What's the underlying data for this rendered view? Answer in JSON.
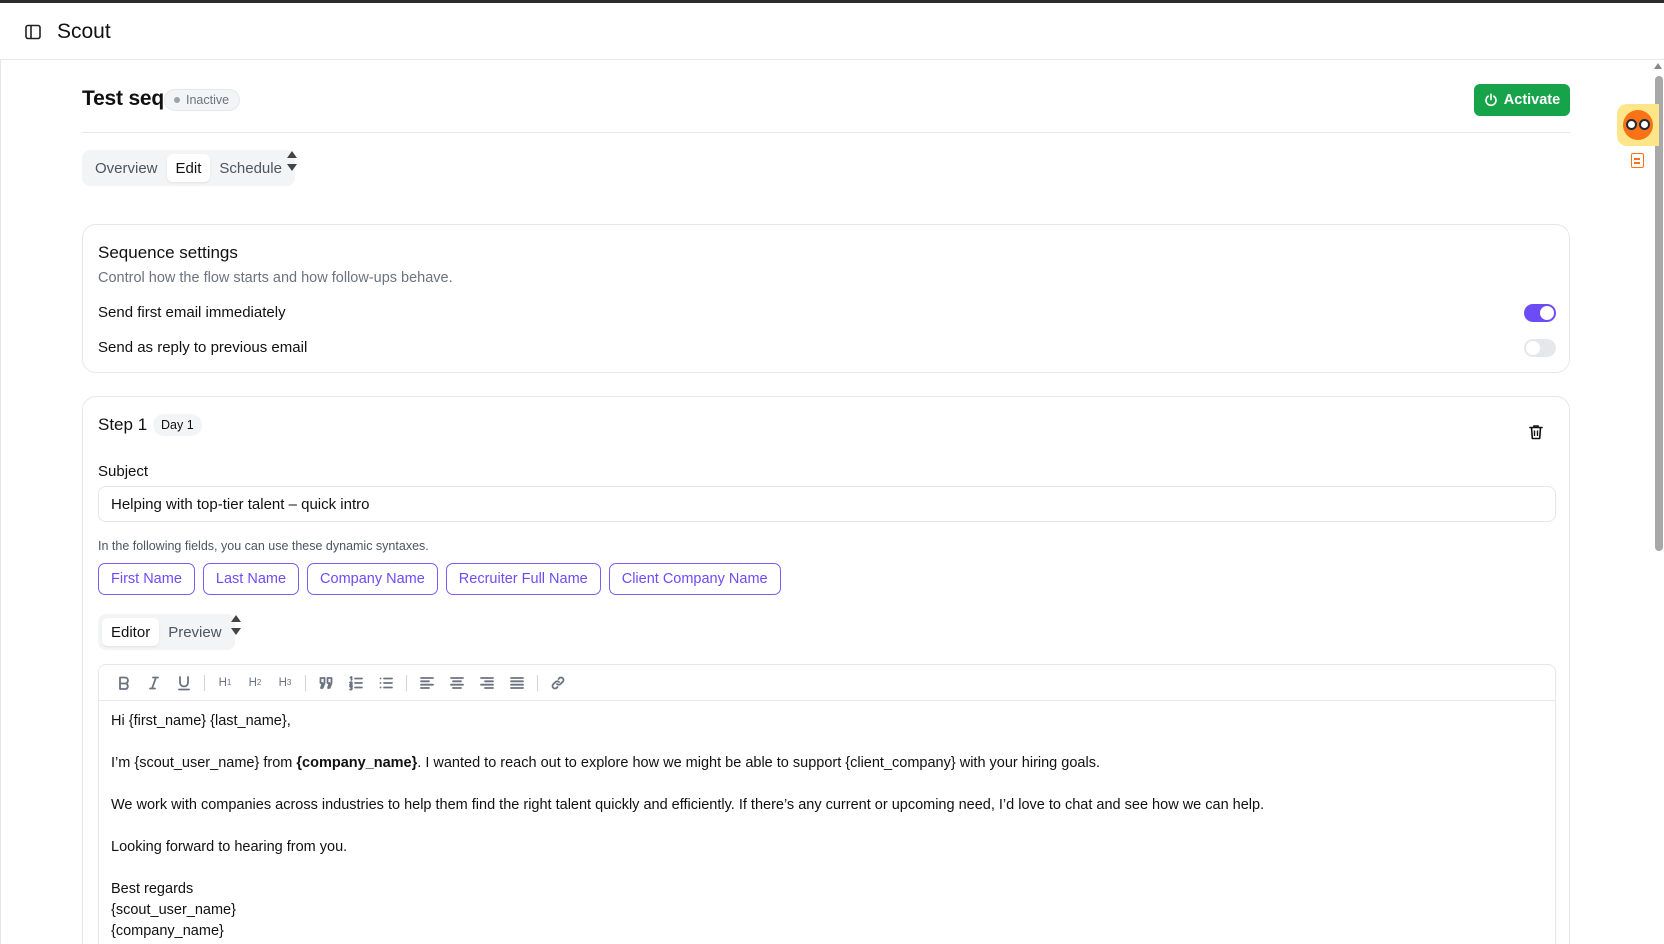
{
  "app": {
    "title": "Scout"
  },
  "page": {
    "title": "Test seq",
    "status": "Inactive",
    "activate_label": "Activate"
  },
  "tabs": [
    {
      "label": "Overview",
      "active": false
    },
    {
      "label": "Edit",
      "active": true
    },
    {
      "label": "Schedule",
      "active": false
    }
  ],
  "settings": {
    "title": "Sequence settings",
    "description": "Control how the flow starts and how follow-ups behave.",
    "items": [
      {
        "label": "Send first email immediately",
        "enabled": true
      },
      {
        "label": "Send as reply to previous email",
        "enabled": false
      }
    ]
  },
  "step": {
    "title": "Step 1",
    "day": "Day 1",
    "subject_label": "Subject",
    "subject_value": "Helping with top-tier talent – quick intro",
    "hint": "In the following fields, you can use these dynamic syntaxes.",
    "chips": [
      "First Name",
      "Last Name",
      "Company Name",
      "Recruiter Full Name",
      "Client Company Name"
    ],
    "editor_tabs": [
      {
        "label": "Editor",
        "active": true
      },
      {
        "label": "Preview",
        "active": false
      }
    ],
    "body": {
      "greeting": "Hi {first_name} {last_name},",
      "intro_pre": "I’m {scout_user_name} from ",
      "intro_bold": "{company_name}",
      "intro_post": ". I wanted to reach out to explore how we might be able to support {client_company} with your hiring goals.",
      "para2": "We work with companies across industries to help them find the right talent quickly and efficiently. If there’s any current or upcoming need, I’d love to chat and see how we can help.",
      "para3": "Looking forward to hearing from you.",
      "signoff": "Best regards",
      "sig_name": "{scout_user_name}",
      "sig_company": "{company_name}"
    }
  },
  "colors": {
    "accent": "#6d4cf6",
    "activate": "#16a34a"
  }
}
